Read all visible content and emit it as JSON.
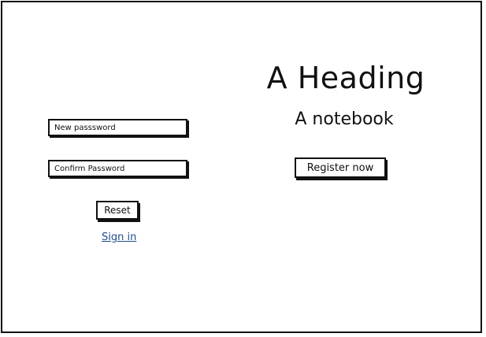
{
  "hero": {
    "heading": "A Heading",
    "subheading": "A notebook",
    "register_label": "Register now"
  },
  "form": {
    "new_password_placeholder": "New passsword",
    "confirm_password_placeholder": "Confirm Password",
    "reset_label": "Reset",
    "sign_in_label": "Sign in"
  },
  "colors": {
    "ink": "#111111",
    "link": "#1f4f8f",
    "background": "#ffffff"
  }
}
